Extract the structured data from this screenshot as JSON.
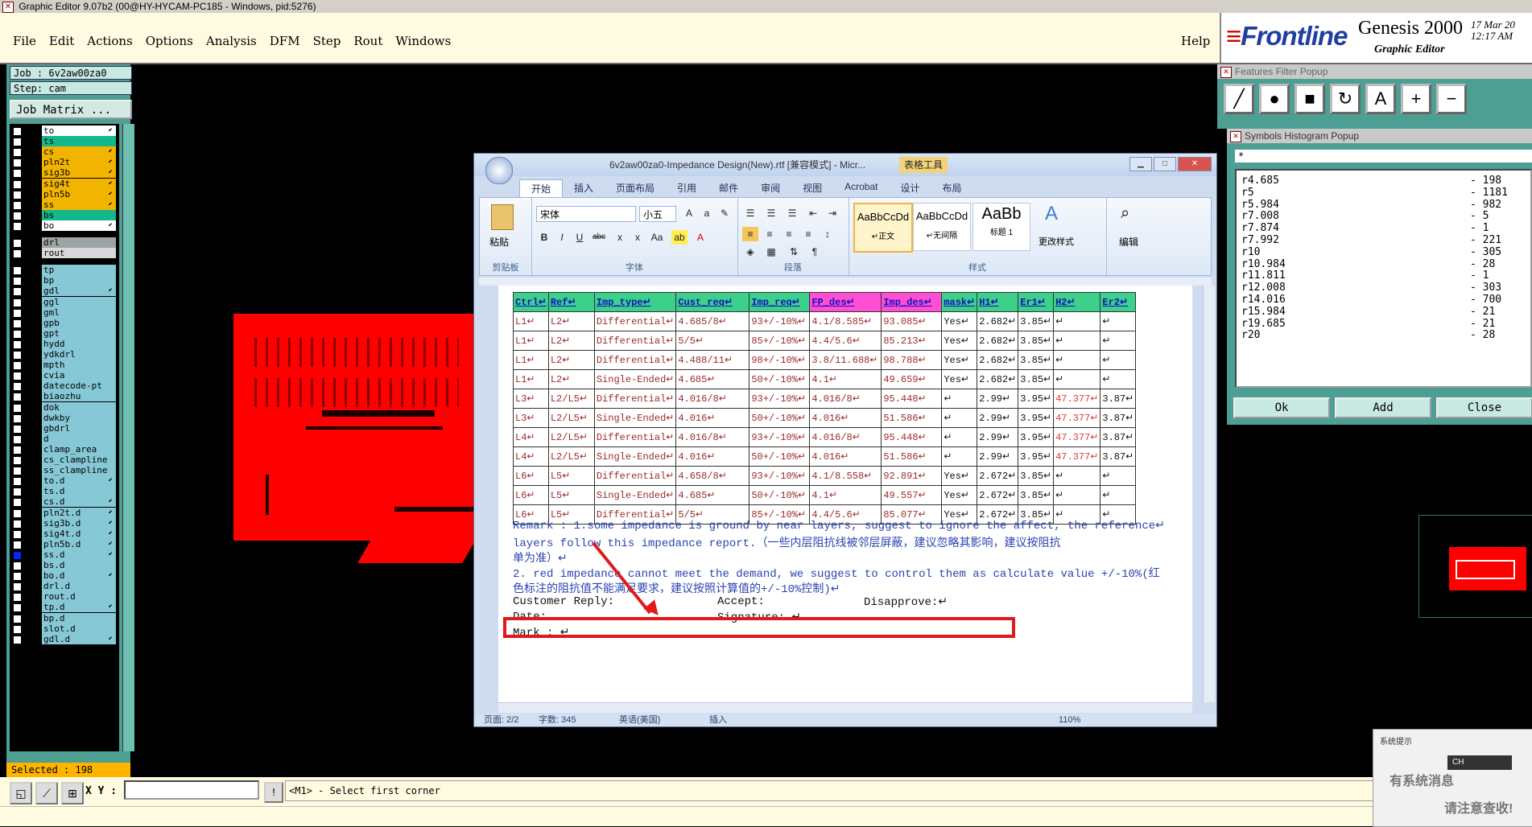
{
  "title": "Graphic Editor 9.07b2 (00@HY-HYCAM-PC185 - Windows, pid:5276)",
  "menu": [
    "File",
    "Edit",
    "Actions",
    "Options",
    "Analysis",
    "DFM",
    "Step",
    "Rout",
    "Windows"
  ],
  "help": "Help",
  "brand": {
    "logo": "Frontline",
    "product": "Genesis 2000",
    "subtitle": "Graphic Editor",
    "date": "17 Mar 20",
    "time": "12:17 AM"
  },
  "job": {
    "job": "Job :  6v2aw00za0",
    "step": "Step:  cam",
    "matrix": "Job Matrix ..."
  },
  "layers": [
    {
      "name": "to",
      "color": "#ffffff",
      "arrow": "⬋",
      "on": false
    },
    {
      "name": "ts",
      "color": "#12b78c",
      "arrow": "",
      "on": false
    },
    {
      "name": "cs",
      "color": "#f2b400",
      "arrow": "⬋",
      "on": false
    },
    {
      "name": "pln2t",
      "color": "#f2b400",
      "arrow": "⬋",
      "on": false
    },
    {
      "name": "sig3b",
      "color": "#f2b400",
      "arrow": "⬋",
      "on": false
    },
    {
      "name": "sig4t",
      "color": "#f2b400",
      "arrow": "⬋",
      "on": false
    },
    {
      "name": "pln5b",
      "color": "#f2b400",
      "arrow": "⬋",
      "on": false
    },
    {
      "name": "ss",
      "color": "#f2b400",
      "arrow": "⬋",
      "on": false
    },
    {
      "name": "bs",
      "color": "#12b78c",
      "arrow": "",
      "on": false
    },
    {
      "name": "bo",
      "color": "#ffffff",
      "arrow": "⬋",
      "on": false
    },
    {
      "name": "drl",
      "color": "#9ea4a6",
      "arrow": "",
      "on": false
    },
    {
      "name": "rout",
      "color": "#d8d8d8",
      "arrow": "",
      "on": false
    },
    {
      "name": "tp",
      "color": "#87c8d6",
      "arrow": "",
      "on": false
    },
    {
      "name": "bp",
      "color": "#87c8d6",
      "arrow": "",
      "on": false
    },
    {
      "name": "gdl",
      "color": "#87c8d6",
      "arrow": "⬋",
      "on": false
    },
    {
      "name": "ggl",
      "color": "#87c8d6",
      "arrow": "",
      "on": false
    },
    {
      "name": "gml",
      "color": "#87c8d6",
      "arrow": "",
      "on": false
    },
    {
      "name": "gpb",
      "color": "#87c8d6",
      "arrow": "",
      "on": false
    },
    {
      "name": "gpt",
      "color": "#87c8d6",
      "arrow": "",
      "on": false
    },
    {
      "name": "hydd",
      "color": "#87c8d6",
      "arrow": "",
      "on": false
    },
    {
      "name": "ydkdrl",
      "color": "#87c8d6",
      "arrow": "",
      "on": false
    },
    {
      "name": "mpth",
      "color": "#87c8d6",
      "arrow": "",
      "on": false
    },
    {
      "name": "cvia",
      "color": "#87c8d6",
      "arrow": "",
      "on": false
    },
    {
      "name": "datecode-pt",
      "color": "#87c8d6",
      "arrow": "",
      "on": false
    },
    {
      "name": "biaozhu",
      "color": "#87c8d6",
      "arrow": "",
      "on": false
    },
    {
      "name": "dok",
      "color": "#87c8d6",
      "arrow": "",
      "on": false
    },
    {
      "name": "dwkby",
      "color": "#87c8d6",
      "arrow": "",
      "on": false
    },
    {
      "name": "gbdrl",
      "color": "#87c8d6",
      "arrow": "",
      "on": false
    },
    {
      "name": "d",
      "color": "#87c8d6",
      "arrow": "",
      "on": false
    },
    {
      "name": "clamp_area",
      "color": "#87c8d6",
      "arrow": "",
      "on": false
    },
    {
      "name": "cs_clampline",
      "color": "#87c8d6",
      "arrow": "",
      "on": false
    },
    {
      "name": "ss_clampline",
      "color": "#87c8d6",
      "arrow": "",
      "on": false
    },
    {
      "name": "to.d",
      "color": "#87c8d6",
      "arrow": "⬋",
      "on": false
    },
    {
      "name": "ts.d",
      "color": "#87c8d6",
      "arrow": "",
      "on": false
    },
    {
      "name": "cs.d",
      "color": "#87c8d6",
      "arrow": "⬋",
      "on": false
    },
    {
      "name": "pln2t.d",
      "color": "#87c8d6",
      "arrow": "⬋",
      "on": false
    },
    {
      "name": "sig3b.d",
      "color": "#87c8d6",
      "arrow": "⬋",
      "on": false
    },
    {
      "name": "sig4t.d",
      "color": "#87c8d6",
      "arrow": "⬋",
      "on": false
    },
    {
      "name": "pln5b.d",
      "color": "#87c8d6",
      "arrow": "⬋",
      "on": false
    },
    {
      "name": "ss.d",
      "color": "#87c8d6",
      "arrow": "⬋",
      "on": true
    },
    {
      "name": "bs.d",
      "color": "#87c8d6",
      "arrow": "",
      "on": false
    },
    {
      "name": "bo.d",
      "color": "#87c8d6",
      "arrow": "⬋",
      "on": false
    },
    {
      "name": "drl.d",
      "color": "#87c8d6",
      "arrow": "",
      "on": false
    },
    {
      "name": "rout.d",
      "color": "#87c8d6",
      "arrow": "",
      "on": false
    },
    {
      "name": "tp.d",
      "color": "#87c8d6",
      "arrow": "⬋",
      "on": false
    },
    {
      "name": "bp.d",
      "color": "#87c8d6",
      "arrow": "",
      "on": false
    },
    {
      "name": "slot.d",
      "color": "#87c8d6",
      "arrow": "",
      "on": false
    },
    {
      "name": "gdl.d",
      "color": "#87c8d6",
      "arrow": "⬋",
      "on": false
    }
  ],
  "selected": "Selected : 198",
  "bottom": {
    "xy_label": "X Y :",
    "info_btn": "!",
    "prompt": "<M1> - Select first corner"
  },
  "word": {
    "title": "6v2aw00za0-Impedance Design(New).rtf [兼容模式] - Micr...",
    "table_tools": "表格工具",
    "tabs": [
      "开始",
      "插入",
      "页面布局",
      "引用",
      "邮件",
      "审阅",
      "视图",
      "Acrobat",
      "设计",
      "布局"
    ],
    "groups": {
      "clipboard": "剪贴板",
      "font": "字体",
      "paragraph": "段落",
      "styles": "样式"
    },
    "paste": "粘贴",
    "font_name": "宋体",
    "font_size": "小五",
    "styles": [
      {
        "sample": "AaBbCcDd",
        "name": "↵正文"
      },
      {
        "sample": "AaBbCcDd",
        "name": "↵无间隔"
      },
      {
        "sample": "AaBb",
        "name": "标题 1"
      }
    ],
    "change_styles": "更改样式",
    "edit": "编辑",
    "status": {
      "page": "页面: 2/2",
      "words": "字数: 345",
      "lang": "英语(美国)",
      "mode": "插入",
      "zoom": "110%"
    },
    "table_headers": [
      "Ctrl↵",
      "Ref↵",
      "Imp_type↵",
      "Cust_req↵",
      "Imp_req↵",
      "FP_des↵",
      "Imp_des↵",
      "mask↵",
      "H1↵",
      "Er1↵",
      "H2↵",
      "Er2↵"
    ],
    "table_rows": [
      [
        "L1↵",
        "L2↵",
        "Differential↵",
        "4.685/8↵",
        "93+/-10%↵",
        "4.1/8.585↵",
        "93.085↵",
        "Yes↵",
        "2.682↵",
        "3.85↵",
        "↵",
        "↵"
      ],
      [
        "L1↵",
        "L2↵",
        "Differential↵",
        "5/5↵",
        "85+/-10%↵",
        "4.4/5.6↵",
        "85.213↵",
        "Yes↵",
        "2.682↵",
        "3.85↵",
        "↵",
        "↵"
      ],
      [
        "L1↵",
        "L2↵",
        "Differential↵",
        "4.488/11↵",
        "98+/-10%↵",
        "3.8/11.688↵",
        "98.788↵",
        "Yes↵",
        "2.682↵",
        "3.85↵",
        "↵",
        "↵"
      ],
      [
        "L1↵",
        "L2↵",
        "Single-Ended↵",
        "4.685↵",
        "50+/-10%↵",
        "4.1↵",
        "49.659↵",
        "Yes↵",
        "2.682↵",
        "3.85↵",
        "↵",
        "↵"
      ],
      [
        "L3↵",
        "L2/L5↵",
        "Differential↵",
        "4.016/8↵",
        "93+/-10%↵",
        "4.016/8↵",
        "95.448↵",
        "↵",
        "2.99↵",
        "3.95↵",
        "47.377↵",
        "3.87↵"
      ],
      [
        "L3↵",
        "L2/L5↵",
        "Single-Ended↵",
        "4.016↵",
        "50+/-10%↵",
        "4.016↵",
        "51.586↵",
        "↵",
        "2.99↵",
        "3.95↵",
        "47.377↵",
        "3.87↵"
      ],
      [
        "L4↵",
        "L2/L5↵",
        "Differential↵",
        "4.016/8↵",
        "93+/-10%↵",
        "4.016/8↵",
        "95.448↵",
        "↵",
        "2.99↵",
        "3.95↵",
        "47.377↵",
        "3.87↵"
      ],
      [
        "L4↵",
        "L2/L5↵",
        "Single-Ended↵",
        "4.016↵",
        "50+/-10%↵",
        "4.016↵",
        "51.586↵",
        "↵",
        "2.99↵",
        "3.95↵",
        "47.377↵",
        "3.87↵"
      ],
      [
        "L6↵",
        "L5↵",
        "Differential↵",
        "4.658/8↵",
        "93+/-10%↵",
        "4.1/8.558↵",
        "92.891↵",
        "Yes↵",
        "2.672↵",
        "3.85↵",
        "↵",
        "↵"
      ],
      [
        "L6↵",
        "L5↵",
        "Single-Ended↵",
        "4.685↵",
        "50+/-10%↵",
        "4.1↵",
        "49.557↵",
        "Yes↵",
        "2.672↵",
        "3.85↵",
        "↵",
        "↵"
      ],
      [
        "L6↵",
        "L5↵",
        "Differential↵",
        "5/5↵",
        "85+/-10%↵",
        "4.4/5.6↵",
        "85.077↵",
        "Yes↵",
        "2.672↵",
        "3.85↵",
        "↵",
        "↵"
      ]
    ],
    "remark1": "Remark : 1.some impedance is ground by near layers, suggest to ignore the affect, the reference↵",
    "remark2": "layers follow this impedance report.（一些内层阻抗线被邻层屏蔽，建议忽略其影响，建议按阻抗",
    "remark3": "单为准）↵",
    "remark4": "2. red impedance cannot meet the demand, we suggest to control them as calculate value +/-10%(红",
    "remark5": "色标注的阻抗值不能满足要求，建议按照计算值的+/-10%控制)↵",
    "reply_label": "Customer Reply:",
    "accept_label": "Accept:",
    "disapprove_label": "Disapprove:↵",
    "date_label": "Date:.",
    "signature_label": "Signature: ↵",
    "mark_label": "Mark : ↵",
    "red_accent": "#e01a1a"
  },
  "features_filter": {
    "title": "Features Filter Popup",
    "tools": [
      "╱",
      "●",
      "■",
      "↻",
      "A",
      "+",
      "−"
    ]
  },
  "symbols_histogram": {
    "title": "Symbols Histogram Popup",
    "filter": "*",
    "items": [
      {
        "name": "r4.685",
        "count": "- 198"
      },
      {
        "name": "r5",
        "count": "- 1181"
      },
      {
        "name": "r5.984",
        "count": "- 982"
      },
      {
        "name": "r7.008",
        "count": "- 5"
      },
      {
        "name": "r7.874",
        "count": "- 1"
      },
      {
        "name": "r7.992",
        "count": "- 221"
      },
      {
        "name": "r10",
        "count": "- 305"
      },
      {
        "name": "r10.984",
        "count": "- 28"
      },
      {
        "name": "r11.811",
        "count": "- 1"
      },
      {
        "name": "r12.008",
        "count": "- 303"
      },
      {
        "name": "r14.016",
        "count": "- 700"
      },
      {
        "name": "r15.984",
        "count": "- 21"
      },
      {
        "name": "r19.685",
        "count": "- 21"
      },
      {
        "name": "r20",
        "count": "- 28"
      }
    ],
    "ok": "Ok",
    "add": "Add",
    "close": "Close"
  },
  "notify": {
    "title": "系统提示",
    "line1": "有系统消息",
    "line2": "请注意查收!",
    "lang": "CH"
  }
}
